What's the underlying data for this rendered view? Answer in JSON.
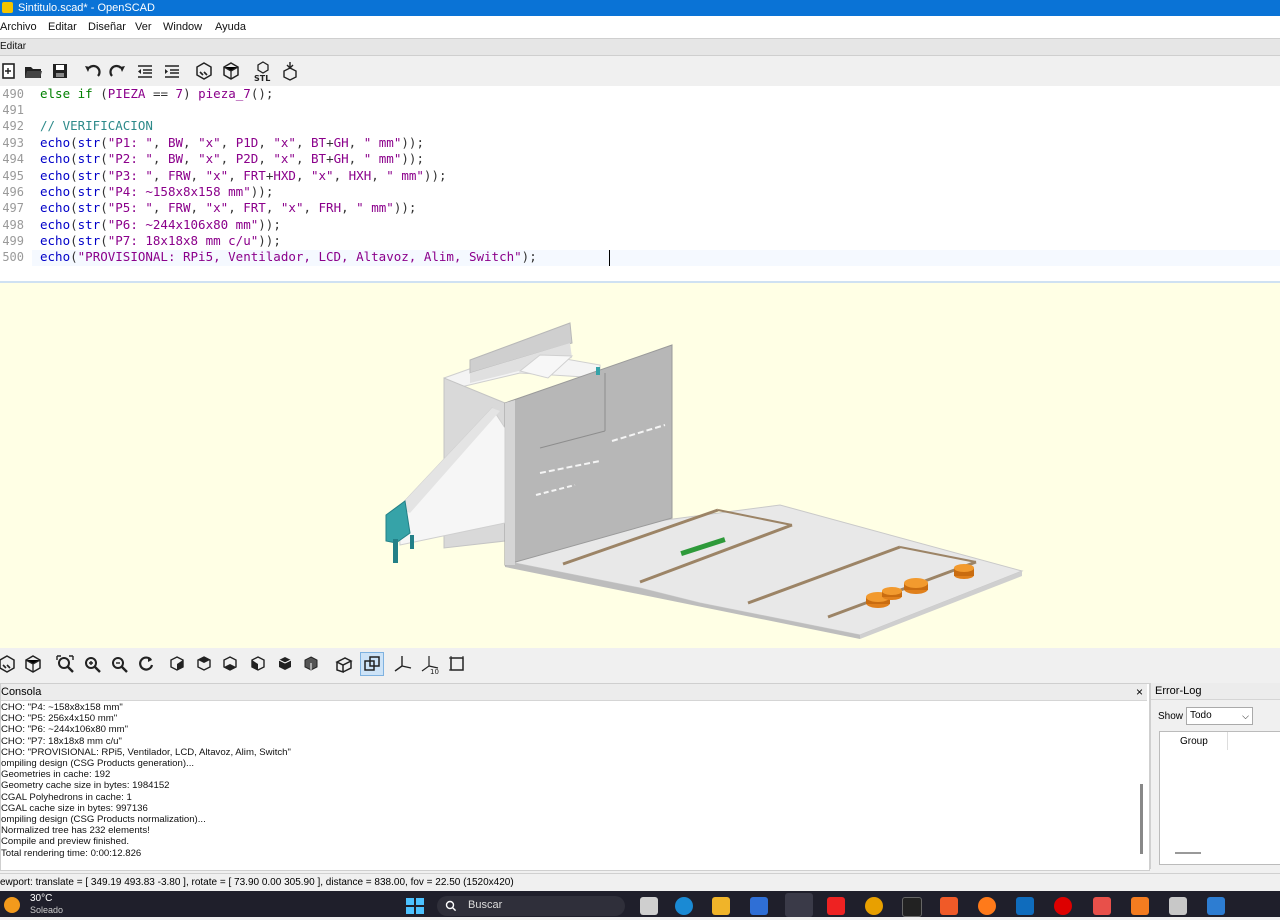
{
  "window": {
    "title": "Sintitulo.scad* - OpenSCAD"
  },
  "menu": [
    "Archivo",
    "Editar",
    "Diseñar",
    "Ver",
    "Window",
    "Ayuda"
  ],
  "editor_tab": "Editar",
  "editor_toolbar": [
    "new-file-icon",
    "open-file-icon",
    "save-icon",
    "undo-icon",
    "redo-icon",
    "unindent-icon",
    "indent-icon",
    "preview-icon",
    "render-icon",
    "export-stl-icon",
    "send-to-print-icon"
  ],
  "code": {
    "lines": [
      {
        "n": "490",
        "text": "else if (PIEZA == 7) pieza_7();"
      },
      {
        "n": "491",
        "text": ""
      },
      {
        "n": "492",
        "text": "// VERIFICACION"
      },
      {
        "n": "493",
        "text": "echo(str(\"P1: \", BW, \"x\", P1D, \"x\", BT+GH, \" mm\"));"
      },
      {
        "n": "494",
        "text": "echo(str(\"P2: \", BW, \"x\", P2D, \"x\", BT+GH, \" mm\"));"
      },
      {
        "n": "495",
        "text": "echo(str(\"P3: \", FRW, \"x\", FRT+HXD, \"x\", HXH, \" mm\"));"
      },
      {
        "n": "496",
        "text": "echo(str(\"P4: ~158x8x158 mm\"));"
      },
      {
        "n": "497",
        "text": "echo(str(\"P5: \", FRW, \"x\", FRT, \"x\", FRH, \" mm\"));"
      },
      {
        "n": "498",
        "text": "echo(str(\"P6: ~244x106x80 mm\"));"
      },
      {
        "n": "499",
        "text": "echo(str(\"P7: 18x18x8 mm c/u\"));"
      },
      {
        "n": "500",
        "text": "echo(\"PROVISIONAL: RPi5, Ventilador, LCD, Altavoz, Alim, Switch\");"
      }
    ]
  },
  "view_toolbar": [
    "preview-icon",
    "render-icon",
    "view-all-icon",
    "zoom-in-icon",
    "zoom-out-icon",
    "reset-view-icon",
    "view-right-icon",
    "view-top-icon",
    "view-bottom-icon",
    "view-left-icon",
    "view-front-icon",
    "view-back-icon",
    "perspective-icon",
    "orthogonal-icon",
    "show-axes-icon",
    "show-scale-icon",
    "show-edges-icon"
  ],
  "console": {
    "title": "Consola",
    "close": "×",
    "lines": [
      "CHO: \"P4: ~158x8x158 mm\"",
      "CHO: \"P5: 256x4x150 mm\"",
      "CHO: \"P6: ~244x106x80 mm\"",
      "CHO: \"P7: 18x18x8 mm c/u\"",
      "CHO: \"PROVISIONAL: RPi5, Ventilador, LCD, Altavoz, Alim, Switch\"",
      "ompiling design (CSG Products generation)...",
      "Geometries in cache: 192",
      "Geometry cache size in bytes: 1984152",
      "CGAL Polyhedrons in cache: 1",
      "CGAL cache size in bytes: 997136",
      "ompiling design (CSG Products normalization)...",
      "Normalized tree has 232 elements!",
      "Compile and preview finished.",
      "Total rendering time: 0:00:12.826"
    ]
  },
  "error_log": {
    "title": "Error-Log",
    "show_label": "Show",
    "show_value": "Todo",
    "column": "Group"
  },
  "status": "ewport: translate = [ 349.19 493.83 -3.80 ], rotate = [ 73.90 0.00 305.90 ], distance = 838.00, fov = 22.50 (1520x420)",
  "taskbar": {
    "temperature": "30°C",
    "weather": "Soleado",
    "search_placeholder": "Buscar"
  }
}
